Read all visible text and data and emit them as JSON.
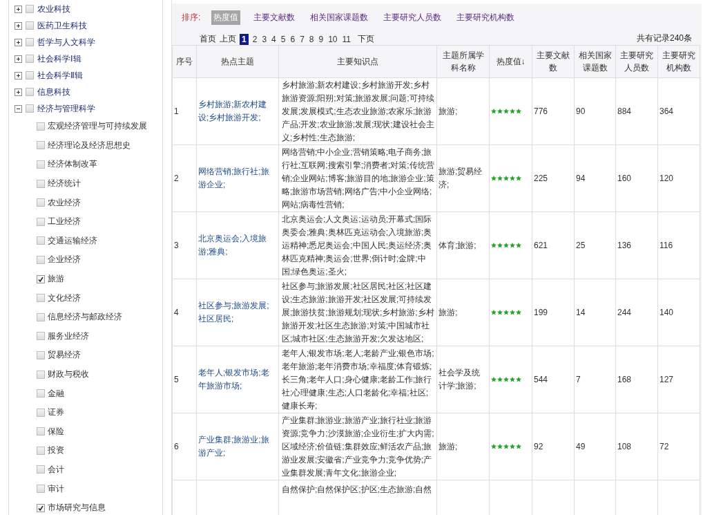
{
  "sidebar": {
    "items": [
      {
        "label": "农业科技",
        "expanded": false,
        "checked": false
      },
      {
        "label": "医药卫生科技",
        "expanded": false,
        "checked": false
      },
      {
        "label": "哲学与人文科学",
        "expanded": false,
        "checked": false
      },
      {
        "label": "社会科学Ⅰ辑",
        "expanded": false,
        "checked": false
      },
      {
        "label": "社会科学Ⅱ辑",
        "expanded": false,
        "checked": false
      },
      {
        "label": "信息科技",
        "expanded": false,
        "checked": false
      },
      {
        "label": "经济与管理科学",
        "expanded": true,
        "checked": false,
        "children": [
          {
            "label": "宏观经济管理与可持续发展",
            "checked": false
          },
          {
            "label": "经济理论及经济思想史",
            "checked": false
          },
          {
            "label": "经济体制改革",
            "checked": false
          },
          {
            "label": "经济统计",
            "checked": false
          },
          {
            "label": "农业经济",
            "checked": false
          },
          {
            "label": "工业经济",
            "checked": false
          },
          {
            "label": "交通运输经济",
            "checked": false
          },
          {
            "label": "企业经济",
            "checked": false
          },
          {
            "label": "旅游",
            "checked": true
          },
          {
            "label": "文化经济",
            "checked": false
          },
          {
            "label": "信息经济与邮政经济",
            "checked": false
          },
          {
            "label": "服务业经济",
            "checked": false
          },
          {
            "label": "贸易经济",
            "checked": false
          },
          {
            "label": "财政与税收",
            "checked": false
          },
          {
            "label": "金融",
            "checked": false
          },
          {
            "label": "证券",
            "checked": false
          },
          {
            "label": "保险",
            "checked": false
          },
          {
            "label": "投资",
            "checked": false
          },
          {
            "label": "会计",
            "checked": false
          },
          {
            "label": "审计",
            "checked": false
          },
          {
            "label": "市场研究与信息",
            "checked": true
          }
        ]
      }
    ]
  },
  "sort": {
    "label": "排序:",
    "options": [
      {
        "label": "热度值",
        "selected": true
      },
      {
        "label": "主要文献数",
        "selected": false
      },
      {
        "label": "相关国家课题数",
        "selected": false
      },
      {
        "label": "主要研究人员数",
        "selected": false
      },
      {
        "label": "主要研究机构数",
        "selected": false
      }
    ]
  },
  "pagination": {
    "first": "首页",
    "prev": "上页",
    "next": "下页",
    "pages": [
      {
        "label": "1",
        "selected": true
      },
      {
        "label": "2",
        "selected": false
      },
      {
        "label": "3",
        "selected": false
      },
      {
        "label": "4",
        "selected": false
      },
      {
        "label": "5",
        "selected": false
      },
      {
        "label": "6",
        "selected": false
      },
      {
        "label": "7",
        "selected": false
      },
      {
        "label": "8",
        "selected": false
      },
      {
        "label": "9",
        "selected": false
      },
      {
        "label": "10",
        "selected": false
      },
      {
        "label": "11",
        "selected": false
      }
    ]
  },
  "record_count": "共有记录240条",
  "table": {
    "columns": [
      "序号",
      "热点主题",
      "主要知识点",
      "主题所属学科名称",
      "热度值↓",
      "主要文献数",
      "相关国家课题数",
      "主要研究人员数",
      "主要研究机构数"
    ],
    "rows": [
      {
        "no": "1",
        "topic": "乡村旅游;新农村建设;乡村旅游开发;",
        "points": "乡村旅游;新农村建设;乡村旅游开发;乡村旅游资源;阳朔;对策;旅游发展;问题;可持续发展;发展模式;生态农业旅游;农家乐;旅游产品;开发;农业旅游;发展;现状;建设社会主义;乡村性;生态旅游;",
        "subject": "旅游;",
        "stars": 5,
        "docs": "776",
        "projects": "90",
        "people": "884",
        "orgs": "364"
      },
      {
        "no": "2",
        "topic": "网络营销;旅行社;旅游企业;",
        "points": "网络营销;中小企业;营销策略;电子商务;旅行社;互联网;搜索引擎;消费者;对策;传统营销;企业网站;博客;旅游目的地;旅游企业;策略;旅游市场营销;网络广告;中小企业网络;网站;病毒性营销;",
        "subject": "旅游;贸易经济;",
        "stars": 5,
        "docs": "225",
        "projects": "94",
        "people": "160",
        "orgs": "120"
      },
      {
        "no": "3",
        "topic": "北京奥运会;入境旅游;雅典;",
        "points": "北京奥运会;人文奥运;运动员;开幕式;国际奥委会;雅典;奥林匹克运动会;入境旅游;奥运精神;悉尼奥运会;中国人民;奥运经济;奥林匹克精神;奥运会;世界;倒计时;金牌;中国;绿色奥运;圣火;",
        "subject": "体育;旅游;",
        "stars": 5,
        "docs": "621",
        "projects": "25",
        "people": "136",
        "orgs": "116"
      },
      {
        "no": "4",
        "topic": "社区参与;旅游发展;社区居民;",
        "points": "社区参与;旅游发展;社区居民;社区;社区建设;生态旅游;旅游开发;社区发展;可持续发展;旅游扶贫;旅游规划;现状;乡村旅游;乡村旅游开发;社区生态旅游;对策;中国城市社区;城市社区;生态旅游开发;欠发达地区;",
        "subject": "旅游;",
        "stars": 5,
        "docs": "199",
        "projects": "14",
        "people": "244",
        "orgs": "140"
      },
      {
        "no": "5",
        "topic": "老年人;银发市场;老年旅游市场;",
        "points": "老年人;银发市场;老人;老龄产业;银色市场;老年旅游;老年消费市场;幸福度;体育锻炼;长三角;老年人口;身心健康;老龄工作;旅行社;心理健康;生态;人口老龄化;幸福;社区;健康长寿;",
        "subject": "社会学及统计学;旅游;",
        "stars": 5,
        "docs": "544",
        "projects": "7",
        "people": "168",
        "orgs": "127"
      },
      {
        "no": "6",
        "topic": "产业集群;旅游业;旅游产业;",
        "points": "产业集群;旅游业;旅游产业;旅行社业;旅游资源;竞争力;沙漠旅游;企业衍生;扩大内需;区域经济;价值链;集群效应;鲜活农产品;旅游业发展;安徽省;产业竞争力;竞争优势;产业集群发展;青年文化;旅游企业;",
        "subject": "旅游;",
        "stars": 5,
        "docs": "92",
        "projects": "49",
        "people": "108",
        "orgs": "72"
      },
      {
        "points": "自然保护;自然保护区;护区;生态旅游;自然"
      }
    ]
  }
}
